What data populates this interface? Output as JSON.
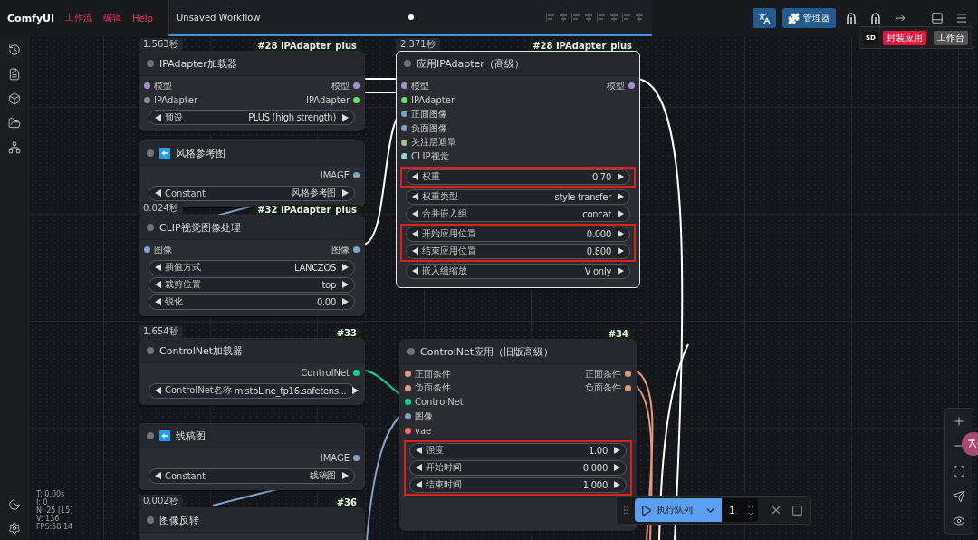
{
  "app_name": "ComfyUI",
  "menu": [
    {
      "label": "工作流"
    },
    {
      "label": "编辑"
    },
    {
      "label": "Help"
    }
  ],
  "workflow_tab": {
    "title": "Unsaved Workflow",
    "modified": true
  },
  "manager_button": {
    "label": "管理器"
  },
  "app_popup": {
    "logo": "SD",
    "publish_label": "封装应用",
    "workbench_label": "工作台"
  },
  "stats": [
    "T: 0.00s",
    "I: 0",
    "N: 25 [15]",
    "V: 136",
    "FPS:58.14"
  ],
  "nodes": [
    {
      "time": "1.563秒",
      "badge": "#28 IPAdapter_plus",
      "title": "IPAdapter加载器",
      "kind": "plain",
      "selected": false,
      "inputs": [
        {
          "label": "模型",
          "color": "#a48fcf"
        },
        {
          "label": "IPAdapter",
          "color": "#8a8a8a"
        }
      ],
      "outputs": [
        {
          "label": "模型",
          "color": "#a48fcf"
        },
        {
          "label": "IPAdapter",
          "color": "#5ee85e"
        }
      ],
      "widgets": [
        {
          "label": "预设",
          "value": "PLUS (high strength)",
          "highlighted": false
        }
      ]
    },
    {
      "title": "风格参考图",
      "kind": "input",
      "selected": false,
      "outputs": [
        {
          "label": "IMAGE",
          "color": "#7fa4cc"
        }
      ],
      "widgets": [
        {
          "label": "Constant",
          "value": "风格参考图",
          "highlighted": false
        }
      ]
    },
    {
      "time": "0.024秒",
      "badge": "#32 IPAdapter_plus",
      "title": "CLIP视觉图像处理",
      "kind": "plain",
      "selected": false,
      "inputs": [
        {
          "label": "图像",
          "color": "#7fa4cc"
        }
      ],
      "outputs": [
        {
          "label": "图像",
          "color": "#7fa4cc"
        }
      ],
      "widgets": [
        {
          "label": "插值方式",
          "value": "LANCZOS",
          "highlighted": false
        },
        {
          "label": "裁剪位置",
          "value": "top",
          "highlighted": false
        },
        {
          "label": "锐化",
          "value": "0.00",
          "highlighted": false
        }
      ]
    },
    {
      "time": "2.371秒",
      "badge": "#28 IPAdapter_plus",
      "title": "应用IPAdapter（高级）",
      "kind": "plain",
      "selected": true,
      "inputs": [
        {
          "label": "模型",
          "color": "#a48fcf"
        },
        {
          "label": "IPAdapter",
          "color": "#5ee85e"
        },
        {
          "label": "正面图像",
          "color": "#7fa4cc"
        },
        {
          "label": "负面图像",
          "color": "#7fa4cc"
        },
        {
          "label": "关注层遮罩",
          "color": "#a9c27e"
        },
        {
          "label": "CLIP视觉",
          "color": "#8fd4d4"
        }
      ],
      "outputs": [
        {
          "label": "模型",
          "color": "#a48fcf"
        }
      ],
      "widgets": [
        {
          "label": "权重",
          "value": "0.70",
          "highlighted": true
        },
        {
          "label": "权重类型",
          "value": "style transfer",
          "highlighted": false
        },
        {
          "label": "合并嵌入组",
          "value": "concat",
          "highlighted": false
        },
        {
          "label": "开始应用位置",
          "value": "0.000",
          "highlighted": true
        },
        {
          "label": "结束应用位置",
          "value": "0.800",
          "highlighted": true
        },
        {
          "label": "嵌入组缩放",
          "value": "V only",
          "highlighted": false
        }
      ]
    },
    {
      "time": "1.654秒",
      "badge": "#33",
      "title": "ControlNet加载器",
      "kind": "plain",
      "selected": false,
      "outputs": [
        {
          "label": "ControlNet",
          "color": "#00d68f"
        }
      ],
      "widgets": [
        {
          "label": "ControlNet名称",
          "value": "mistoLine_fp16.safetens...",
          "highlighted": false
        }
      ]
    },
    {
      "title": "线稿图",
      "kind": "input",
      "selected": false,
      "outputs": [
        {
          "label": "IMAGE",
          "color": "#7fa4cc"
        }
      ],
      "widgets": [
        {
          "label": "Constant",
          "value": "线稿图",
          "highlighted": false
        }
      ]
    },
    {
      "time": "0.002秒",
      "badge": "#36",
      "title": "图像反转",
      "kind": "plain",
      "selected": false
    },
    {
      "badge": "#34",
      "title": "ControlNet应用（旧版高级）",
      "kind": "plain",
      "selected": false,
      "inputs": [
        {
          "label": "正面条件",
          "color": "#e39a7a"
        },
        {
          "label": "负面条件",
          "color": "#e39a7a"
        },
        {
          "label": "ControlNet",
          "color": "#00d68f"
        },
        {
          "label": "图像",
          "color": "#7fa4cc"
        },
        {
          "label": "vae",
          "color": "#ff6b6b"
        }
      ],
      "outputs": [
        {
          "label": "正面条件",
          "color": "#e39a7a"
        },
        {
          "label": "负面条件",
          "color": "#e39a7a"
        }
      ],
      "widgets": [
        {
          "label": "强度",
          "value": "1.00",
          "highlighted": true
        },
        {
          "label": "开始时间",
          "value": "0.000",
          "highlighted": true
        },
        {
          "label": "结束时间",
          "value": "1.000",
          "highlighted": true
        }
      ]
    }
  ],
  "queue": {
    "run_label": "执行队列",
    "count": "1"
  }
}
